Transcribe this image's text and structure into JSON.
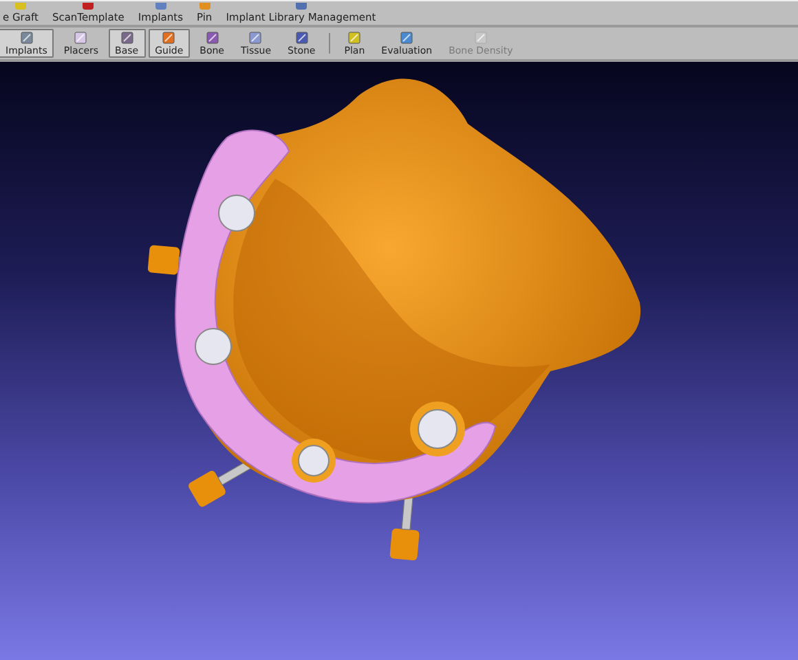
{
  "menu_tabs": [
    {
      "label": "e Graft"
    },
    {
      "label": "ScanTemplate"
    },
    {
      "label": "Implants"
    },
    {
      "label": "Pin"
    },
    {
      "label": "Implant Library Management"
    }
  ],
  "toolbar_groups": [
    [
      {
        "label": "Implants",
        "selected": true,
        "disabled": false
      },
      {
        "label": "Placers",
        "selected": false,
        "disabled": false
      },
      {
        "label": "Base",
        "selected": true,
        "disabled": false
      },
      {
        "label": "Guide",
        "selected": true,
        "disabled": false
      },
      {
        "label": "Bone",
        "selected": false,
        "disabled": false
      },
      {
        "label": "Tissue",
        "selected": false,
        "disabled": false
      },
      {
        "label": "Stone",
        "selected": false,
        "disabled": false
      }
    ],
    [
      {
        "label": "Plan",
        "selected": false,
        "disabled": false
      },
      {
        "label": "Evaluation",
        "selected": false,
        "disabled": false
      },
      {
        "label": "Bone Density",
        "selected": false,
        "disabled": true
      }
    ]
  ]
}
